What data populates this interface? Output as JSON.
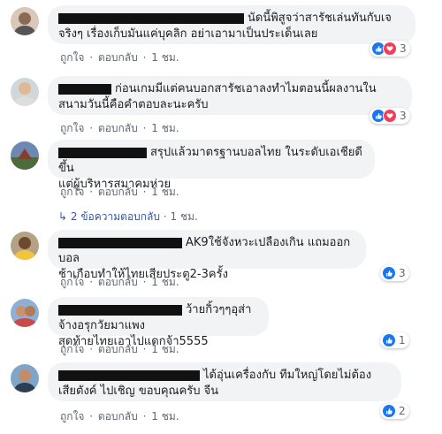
{
  "actions": {
    "like": "ถูกใจ",
    "reply": "ตอบกลับ",
    "sep": "·"
  },
  "comments": [
    {
      "line1": "นัดนี้พิสูจว่าสารัชเล่นทันกับเจ",
      "line2": "จริงๆ เรื่องเก็บมันแค่บุคลิก อย่าเอามาเป็นประเด็นเลย",
      "time": "1 ชม.",
      "reactions": [
        "like",
        "love"
      ],
      "count": "3"
    },
    {
      "line1": "ก่อนเกมมีแต่คนบอกสารัชเอาลงทำไมตอนนี้ผลงานใน",
      "line2": "สนามวันนี้คือคำตอบละนะครับ",
      "time": "1 ชม.",
      "reactions": [
        "like",
        "love"
      ],
      "count": "3"
    },
    {
      "line1": "สรุปแล้วมาตรฐานบอลไทย ในระดับเอเชียดีขึ้น",
      "line2": "แต่ผู้บริหารสมาคมห่วย",
      "time": "1 ชม.",
      "reactions": [],
      "count": ""
    },
    {
      "line1": "AK9ใช้จังหวะเปลืองเกิน แถมออกบอล",
      "line2": "ช้าเกือบทำให้ไทยเสียประตู2-3ครั้ง",
      "time": "1 ชม.",
      "reactions": [
        "like"
      ],
      "count": "3"
    },
    {
      "line1": "ว้ายกิ้วๆๆอุส่าจ้างอรุกวัยมาแพง",
      "line2": "สุดท้ายไทยเอาไปแดกจ้า5555",
      "time": "1 ชม.",
      "reactions": [
        "like"
      ],
      "count": "1"
    },
    {
      "line1": "ได้อุ่นเครื่องกับ ทีมใหญ่โดยไม่ต้อง",
      "line2": "เสียตังค์ ไปเชิญ ขอบคุณครับ จีน",
      "time": "1 ชม.",
      "reactions": [
        "like"
      ],
      "count": "2"
    }
  ],
  "replies": {
    "label": "2 ข้อความตอบกลับ",
    "time": "1 ชม."
  }
}
